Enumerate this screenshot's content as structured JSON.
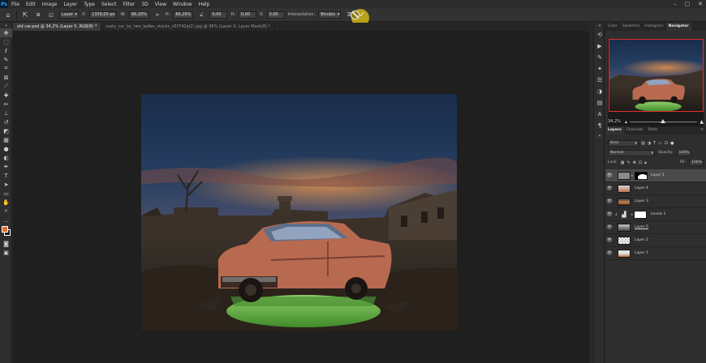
{
  "menu": {
    "app_logo": "Ps",
    "items": [
      "File",
      "Edit",
      "Image",
      "Layer",
      "Type",
      "Select",
      "Filter",
      "3D",
      "View",
      "Window",
      "Help"
    ],
    "window_controls": [
      "–",
      "▢",
      "✕"
    ]
  },
  "options": {
    "reference_label": "Layer",
    "x_label": "X:",
    "x_value": "1359,00 px",
    "w_label": "W:",
    "w_value": "66,26%",
    "h_label": "H:",
    "h_value": "66,26%",
    "angle_value": "0,00",
    "skew_h_label": "H:",
    "skew_h_value": "0,00",
    "skew_v_label": "V:",
    "skew_v_value": "0,00",
    "interpolation_label": "Interpolation:",
    "interpolation_value": "Bicubic"
  },
  "tabs": [
    {
      "label": "old car.psd @ 34,2% (Layer 5, RGB/8) *",
      "active": true
    },
    {
      "label": "rusty_car_by_two_ladies_stocks_d1f742q(2).jpg @ 36% (Layer 0, Layer Mask/8) *",
      "active": false
    }
  ],
  "panels": {
    "top_tabs": [
      "Color",
      "Swatches",
      "Histogram",
      "Navigator"
    ],
    "active_top_tab": "Navigator",
    "zoom_value": "34,2%",
    "zoom_slider_fraction": 0.45,
    "layer_tabs": [
      "Layers",
      "Channels",
      "Paths"
    ],
    "kind_label": "Kind",
    "blend_mode": "Normal",
    "opacity_label": "Opacity:",
    "opacity_value": "100%",
    "lock_label": "Lock:",
    "fill_label": "Fill:",
    "fill_value": "100%"
  },
  "layers": [
    {
      "name": "Layer 1",
      "selected": true,
      "type": "smart-mask"
    },
    {
      "name": "Layer 4",
      "selected": false,
      "type": "image"
    },
    {
      "name": "Layer 3",
      "selected": false,
      "type": "image"
    },
    {
      "name": "Levels 1",
      "selected": false,
      "type": "adjustment"
    },
    {
      "name": "Layer 0",
      "selected": false,
      "type": "image"
    },
    {
      "name": "Layer 2",
      "selected": false,
      "type": "image"
    },
    {
      "name": "Layer 1",
      "selected": false,
      "type": "image"
    }
  ],
  "colors": {
    "foreground": "#e36d2b",
    "background": "#1a1a1a",
    "accent": "#31a8ff",
    "navigator_frame": "#e03030"
  }
}
